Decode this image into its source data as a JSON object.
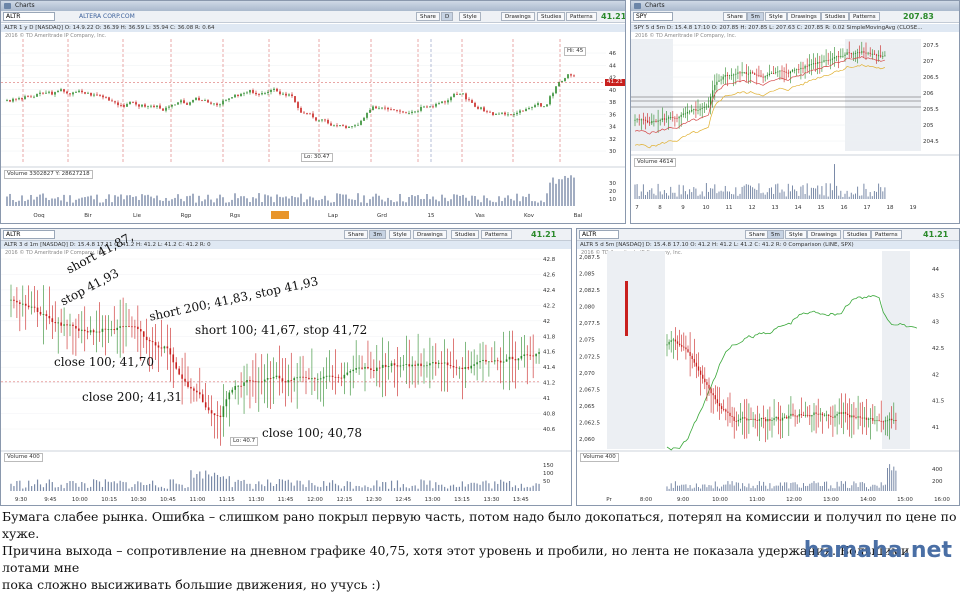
{
  "panels": {
    "p1": {
      "title": "Charts",
      "symbol": "ALTR",
      "domain": "ALTERA CORP.COM",
      "buttons": [
        "Share",
        "Style",
        "Drawings",
        "Studies",
        "Patterns"
      ],
      "price": "41.21",
      "period": "D",
      "info": "ALTR 1 y D [NASDAQ]  O: 14.9.22  O: 36.39  H: 36.59  L: 35.94  C: 36.08  R: 0.64",
      "copyright": "2016 © TD Ameritrade IP Company, Inc.",
      "months": [
        "Ooq",
        "Bir",
        "Lie",
        "Rgp",
        "Rgs",
        "Spa",
        "Lap",
        "Grd",
        "15",
        "Vas",
        "Kov",
        "Bal"
      ],
      "yticks": [
        "46",
        "44",
        "42",
        "40",
        "38",
        "36",
        "34",
        "32",
        "30"
      ],
      "hi": "Hi: 45",
      "lo": "Lo: 30.47",
      "volume": "Volume  3302827   Y: 28627218",
      "last": "41.21"
    },
    "p2": {
      "title": "Charts",
      "symbol": "SPY",
      "period": "5m",
      "buttons": [
        "Share",
        "Style",
        "Drawings",
        "Studies",
        "Patterns"
      ],
      "price": "207.83",
      "info": "SPY 5 d 5m  D: 15.4.8 17:10  O: 207.85  H: 207.85  L: 207.63  C: 207.85  R: 0.02   SimpleMovingAvg (CLOSE...",
      "copyright": "2016 © TD Ameritrade IP Company, Inc.",
      "yticks": [
        "207.5",
        "207",
        "206.5",
        "206",
        "205.5",
        "205",
        "204.5"
      ],
      "xticks": [
        "7",
        "8",
        "9",
        "10",
        "11",
        "12",
        "13",
        "14",
        "15",
        "16",
        "17",
        "18",
        "19"
      ],
      "volume": "Volume  4614"
    },
    "p3": {
      "symbol": "ALTR",
      "period": "3m",
      "buttons": [
        "Share",
        "Style",
        "Drawings",
        "Studies",
        "Patterns"
      ],
      "price": "41.21",
      "info": "ALTR 3 d 1m [NASDAQ]  D: 15.4.8 17.11  O: 41.2  H: 41.2  L: 41.2  C: 41.2  R: 0",
      "copyright": "2016 © TD Ameritrade IP Company, Inc.",
      "yticks": [
        "42.8",
        "42.6",
        "42.4",
        "42.2",
        "42",
        "41.8",
        "41.6",
        "41.4",
        "41.2",
        "41",
        "40.8",
        "40.6"
      ],
      "xticks": [
        "9:30",
        "9:45",
        "10:00",
        "10:15",
        "10:30",
        "10:45",
        "11:00",
        "11:15",
        "11:30",
        "11:45",
        "12:00",
        "12:15",
        "12:30",
        "12:45",
        "13:00",
        "13:15",
        "13:30",
        "13:45"
      ],
      "lo": "Lo: 40.7",
      "volume": "Volume  400"
    },
    "p4": {
      "symbol": "ALTR",
      "period": "5m",
      "buttons": [
        "Share",
        "Style",
        "Drawings",
        "Studies",
        "Patterns"
      ],
      "price": "41.21",
      "info": "ALTR 5 d 5m [NASDAQ]  D: 15.4.8 17.10  O: 41.2  H: 41.2  L: 41.2  C: 41.2  R: 0   Comparison (LINE, SPX)",
      "copyright": "2016 © TD Ameritrade IP Company, Inc.",
      "yticks": [
        "2,087.5",
        "2,085",
        "2,082.5",
        "2,080",
        "2,077.5",
        "2,075",
        "2,072.5",
        "2,070",
        "2,067.5",
        "2,065",
        "2,062.5",
        "2,060"
      ],
      "ryticks": [
        "44",
        "43.5",
        "43",
        "42.5",
        "42",
        "41.5",
        "41"
      ],
      "xticks": [
        "Pr",
        "8:00",
        "9:00",
        "10:00",
        "11:00",
        "12:00",
        "13:00",
        "14:00",
        "15:00",
        "16:00"
      ],
      "volume": "Volume  400"
    }
  },
  "annotations": {
    "a1": "short 41,87,",
    "a2": "stop 41,93",
    "a3": "short 200; 41,83, stop 41,93",
    "a4": "short 100; 41,67, stop 41,72",
    "a5": "close 100; 41,70",
    "a6": "close 200; 41,31",
    "a7": "close 100; 40,78"
  },
  "caption": {
    "line1": "Бумага слабее рынка. Ошибка – слишком рано покрыл первую часть, потом надо было докопаться, потерял на комиссии и получил по цене по хуже.",
    "line2": "Причина выхода – сопротивление на дневном графике 40,75, хотя этот уровень и пробили, но лента не показала удержания. Большими лотами мне",
    "line3": "пока сложно высиживать большие движения, но учусь :)"
  },
  "logo": "hamaha.net",
  "colors": {
    "up": "#2b8a2b",
    "down": "#c8201e",
    "frame": "#8a98ad"
  }
}
